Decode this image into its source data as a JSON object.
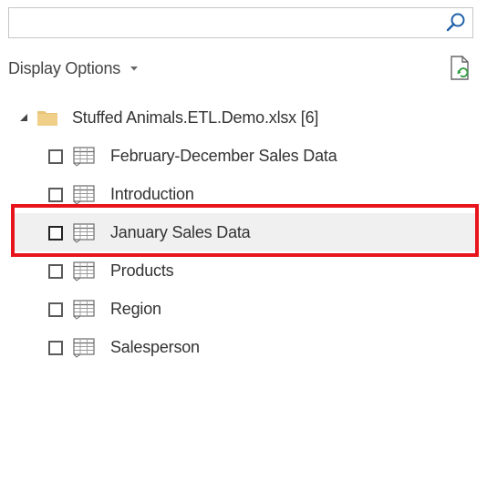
{
  "search": {
    "value": "",
    "placeholder": ""
  },
  "toolbar": {
    "display_options_label": "Display Options",
    "refresh_icon": "refresh-file-icon"
  },
  "tree": {
    "root": {
      "label": "Stuffed Animals.ETL.Demo.xlsx [6]",
      "expanded": true,
      "icon": "folder-icon"
    },
    "items": [
      {
        "label": "February-December Sales Data",
        "checked": false,
        "icon": "table-icon"
      },
      {
        "label": "Introduction",
        "checked": false,
        "icon": "table-icon"
      },
      {
        "label": "January Sales Data",
        "checked": false,
        "icon": "table-icon",
        "selected": true
      },
      {
        "label": "Products",
        "checked": false,
        "icon": "table-icon"
      },
      {
        "label": "Region",
        "checked": false,
        "icon": "table-icon"
      },
      {
        "label": "Salesperson",
        "checked": false,
        "icon": "table-icon"
      }
    ]
  },
  "colors": {
    "highlight": "#e8141c",
    "accent_blue": "#1f5fa8",
    "folder": "#e8c47a",
    "refresh_green": "#2e9b3e",
    "selected_bg": "#f0f0f0"
  }
}
